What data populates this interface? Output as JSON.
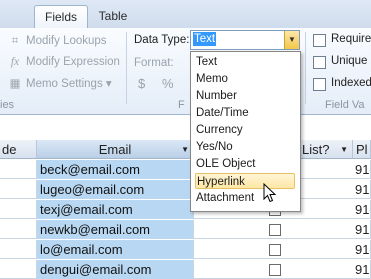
{
  "tabs": [
    {
      "label": "Fields",
      "active": true
    },
    {
      "label": "Table",
      "active": false
    }
  ],
  "ribbon": {
    "modify_lookups": "Modify Lookups",
    "modify_expression": "Modify Expression",
    "memo_settings": "Memo Settings",
    "data_type_label": "Data Type:",
    "data_type_value": "Text",
    "format_label": "Format:",
    "currency_symbol": "$",
    "percent_symbol": "%",
    "required_label": "Require",
    "unique_label": "Unique",
    "indexed_label": "Indexed",
    "group_label_left": "ies",
    "group_label_mid": "F",
    "group_label_right": "Field Va"
  },
  "dropdown": {
    "items": [
      "Text",
      "Memo",
      "Number",
      "Date/Time",
      "Currency",
      "Yes/No",
      "OLE Object",
      "Hyperlink",
      "Attachment"
    ],
    "highlighted": "Hyperlink"
  },
  "grid": {
    "headers": {
      "left": "de",
      "email": "Email",
      "list": "List?",
      "phone": "Pl"
    },
    "rows": [
      {
        "email": "beck@email.com",
        "phone": "91"
      },
      {
        "email": "lugeo@email.com",
        "phone": "91"
      },
      {
        "email": "texj@email.com",
        "phone": "91"
      },
      {
        "email": "newkb@email.com",
        "phone": "91"
      },
      {
        "email": "lo@email.com",
        "phone": "91"
      },
      {
        "email": "dengui@email.com",
        "phone": "91"
      }
    ]
  },
  "colors": {
    "accent": "#3399ff",
    "selection": "#b8d7f2",
    "highlight": "#ffe8a4"
  }
}
